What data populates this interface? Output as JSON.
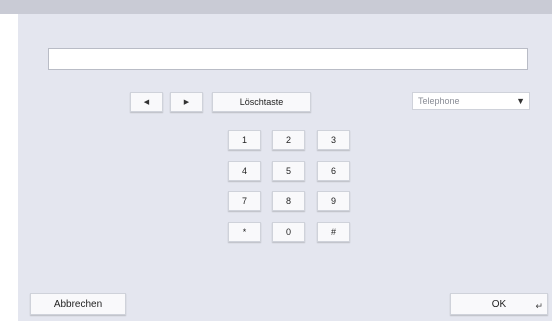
{
  "input": {
    "value": "",
    "placeholder": ""
  },
  "nav": {
    "left_icon": "◀",
    "right_icon": "▶"
  },
  "clear_label": "Löschtaste",
  "select": {
    "value": "Telephone",
    "caret": "▼"
  },
  "keypad": {
    "keys": [
      "1",
      "2",
      "3",
      "4",
      "5",
      "6",
      "7",
      "8",
      "9",
      "*",
      "0",
      "#"
    ]
  },
  "footer": {
    "cancel_label": "Abbrechen",
    "ok_label": "OK",
    "enter_icon": "↵"
  },
  "colors": {
    "dialog_background": "#e4e6ef",
    "top_strip": "#c9cbd5",
    "button_face": "#f9f9fb"
  }
}
